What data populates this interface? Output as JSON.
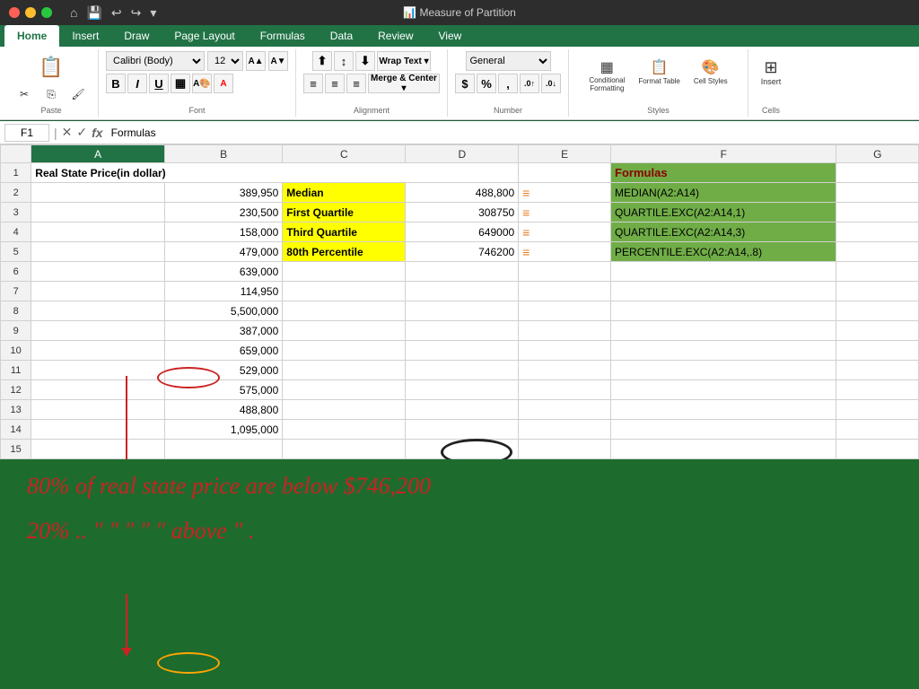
{
  "titlebar": {
    "title": "Measure of Partition"
  },
  "tabs": [
    "Home",
    "Insert",
    "Draw",
    "Page Layout",
    "Formulas",
    "Data",
    "Review",
    "View"
  ],
  "active_tab": "Home",
  "formula_bar": {
    "cell_ref": "F1",
    "formula": "Formulas"
  },
  "ribbon": {
    "font_family": "Calibri (Body)",
    "font_size": "12",
    "number_format": "General"
  },
  "columns": [
    "",
    "A",
    "B",
    "C",
    "D",
    "E",
    "F",
    "G"
  ],
  "rows": [
    {
      "row": "1",
      "a": "Real State Price(in dollar)",
      "b": "",
      "c": "",
      "d": "",
      "e": "",
      "f": "Formulas",
      "g": ""
    },
    {
      "row": "2",
      "a": "",
      "b": "389,950",
      "c": "Median",
      "d": "488,800",
      "e": "",
      "f": "MEDIAN(A2:A14)",
      "g": ""
    },
    {
      "row": "3",
      "a": "",
      "b": "230,500",
      "c": "First Quartile",
      "d": "308750",
      "e": "",
      "f": "QUARTILE.EXC(A2:A14,1)",
      "g": ""
    },
    {
      "row": "4",
      "a": "",
      "b": "158,000",
      "c": "Third Quartile",
      "d": "649000",
      "e": "",
      "f": "QUARTILE.EXC(A2:A14,3)",
      "g": ""
    },
    {
      "row": "5",
      "a": "",
      "b": "479,000",
      "c": "80th Percentile",
      "d": "746200",
      "e": "",
      "f": "PERCENTILE.EXC(A2:A14,.8)",
      "g": ""
    },
    {
      "row": "6",
      "a": "",
      "b": "639,000",
      "c": "",
      "d": "",
      "e": "",
      "f": "",
      "g": ""
    },
    {
      "row": "7",
      "a": "",
      "b": "114,950",
      "c": "",
      "d": "",
      "e": "",
      "f": "",
      "g": ""
    },
    {
      "row": "8",
      "a": "",
      "b": "5,500,000",
      "c": "",
      "d": "",
      "e": "",
      "f": "",
      "g": ""
    },
    {
      "row": "9",
      "a": "",
      "b": "387,000",
      "c": "",
      "d": "",
      "e": "",
      "f": "",
      "g": ""
    },
    {
      "row": "10",
      "a": "",
      "b": "659,000",
      "c": "",
      "d": "",
      "e": "",
      "f": "",
      "g": ""
    },
    {
      "row": "11",
      "a": "",
      "b": "529,000",
      "c": "",
      "d": "",
      "e": "",
      "f": "",
      "g": ""
    },
    {
      "row": "12",
      "a": "",
      "b": "575,000",
      "c": "",
      "d": "",
      "e": "",
      "f": "",
      "g": ""
    },
    {
      "row": "13",
      "a": "",
      "b": "488,800",
      "c": "",
      "d": "",
      "e": "",
      "f": "",
      "g": ""
    },
    {
      "row": "14",
      "a": "",
      "b": "1,095,000",
      "c": "",
      "d": "",
      "e": "",
      "f": "",
      "g": ""
    },
    {
      "row": "15",
      "a": "",
      "b": "",
      "c": "",
      "d": "",
      "e": "",
      "f": "",
      "g": ""
    }
  ],
  "annotation": {
    "line1": "80% of real state price are below $746,200",
    "line2": "20% ..   \"    \"    \"    \"    \"  above  \"  ."
  },
  "format_table_label": "Format Table",
  "cell_styles_label": "Cell Styles"
}
